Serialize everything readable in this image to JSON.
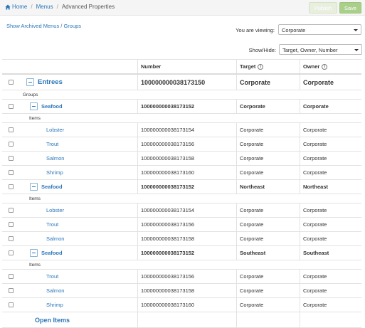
{
  "breadcrumb": {
    "home": "Home",
    "menus": "Menus",
    "current": "Advanced Properties",
    "separator": "/"
  },
  "toolbar": {
    "publish_label": "Publish",
    "save_label": "Save"
  },
  "archived_link": "Show Archived Menus / Groups",
  "viewing": {
    "label": "You are viewing:",
    "value": "Corporate"
  },
  "show_hide": {
    "label": "Show/Hide:",
    "value": "Target, Owner, Number"
  },
  "table": {
    "headers": {
      "number": "Number",
      "target": "Target",
      "owner": "Owner"
    },
    "entree": {
      "name": "Entrees",
      "number": "100000000038173150",
      "target": "Corporate",
      "owner": "Corporate"
    },
    "groups_label": "Groups",
    "items_label": "Items",
    "groups": [
      {
        "name": "Seafood",
        "number": "100000000038173152",
        "target": "Corporate",
        "owner": "Corporate",
        "items": [
          {
            "name": "Lobster",
            "number": "100000000038173154",
            "target": "Corporate",
            "owner": "Corporate"
          },
          {
            "name": "Trout",
            "number": "100000000038173156",
            "target": "Corporate",
            "owner": "Corporate"
          },
          {
            "name": "Salmon",
            "number": "100000000038173158",
            "target": "Corporate",
            "owner": "Corporate"
          },
          {
            "name": "Shrimp",
            "number": "100000000038173160",
            "target": "Corporate",
            "owner": "Corporate"
          }
        ]
      },
      {
        "name": "Seafood",
        "number": "100000000038173152",
        "target": "Northeast",
        "owner": "Northeast",
        "items": [
          {
            "name": "Lobster",
            "number": "100000000038173154",
            "target": "Corporate",
            "owner": "Corporate"
          },
          {
            "name": "Trout",
            "number": "100000000038173156",
            "target": "Corporate",
            "owner": "Corporate"
          },
          {
            "name": "Salmon",
            "number": "100000000038173158",
            "target": "Corporate",
            "owner": "Corporate"
          }
        ]
      },
      {
        "name": "Seafood",
        "number": "100000000038173152",
        "target": "Southeast",
        "owner": "Southeast",
        "items": [
          {
            "name": "Trout",
            "number": "100000000038173156",
            "target": "Corporate",
            "owner": "Corporate"
          },
          {
            "name": "Salmon",
            "number": "100000000038173158",
            "target": "Corporate",
            "owner": "Corporate"
          },
          {
            "name": "Shrimp",
            "number": "100000000038173160",
            "target": "Corporate",
            "owner": "Corporate"
          }
        ]
      }
    ],
    "open_items": "Open Items"
  },
  "colors": {
    "link": "#2a76b8",
    "save_button": "#a9cf8a",
    "publish_button": "#e8efdf",
    "header_bar": "#f5f5f5"
  }
}
